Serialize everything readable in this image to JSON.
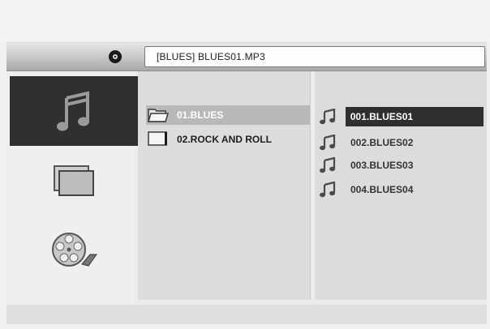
{
  "header": {
    "disc_icon": "disc-icon",
    "path": "[BLUES] BLUES01.MP3"
  },
  "sidebar": {
    "modes": [
      {
        "name": "music",
        "icon": "music-note-icon",
        "active": true
      },
      {
        "name": "photo",
        "icon": "photo-icon",
        "active": false
      },
      {
        "name": "video",
        "icon": "film-reel-icon",
        "active": false
      }
    ]
  },
  "folders": [
    {
      "label": "01.BLUES",
      "icon": "folder-open-icon",
      "selected": true
    },
    {
      "label": "02.ROCK AND ROLL",
      "icon": "folder-icon",
      "selected": false
    }
  ],
  "files": [
    {
      "label": "001.BLUES01",
      "icon": "music-note-icon",
      "selected": true
    },
    {
      "label": "002.BLUES02",
      "icon": "music-note-icon",
      "selected": false
    },
    {
      "label": "003.BLUES03",
      "icon": "music-note-icon",
      "selected": false
    },
    {
      "label": "004.BLUES04",
      "icon": "music-note-icon",
      "selected": false
    }
  ],
  "colors": {
    "selection_dark": "#2f2f2f",
    "selection_gray": "#b9b9b9",
    "panel_bg": "#dcdcdc"
  }
}
